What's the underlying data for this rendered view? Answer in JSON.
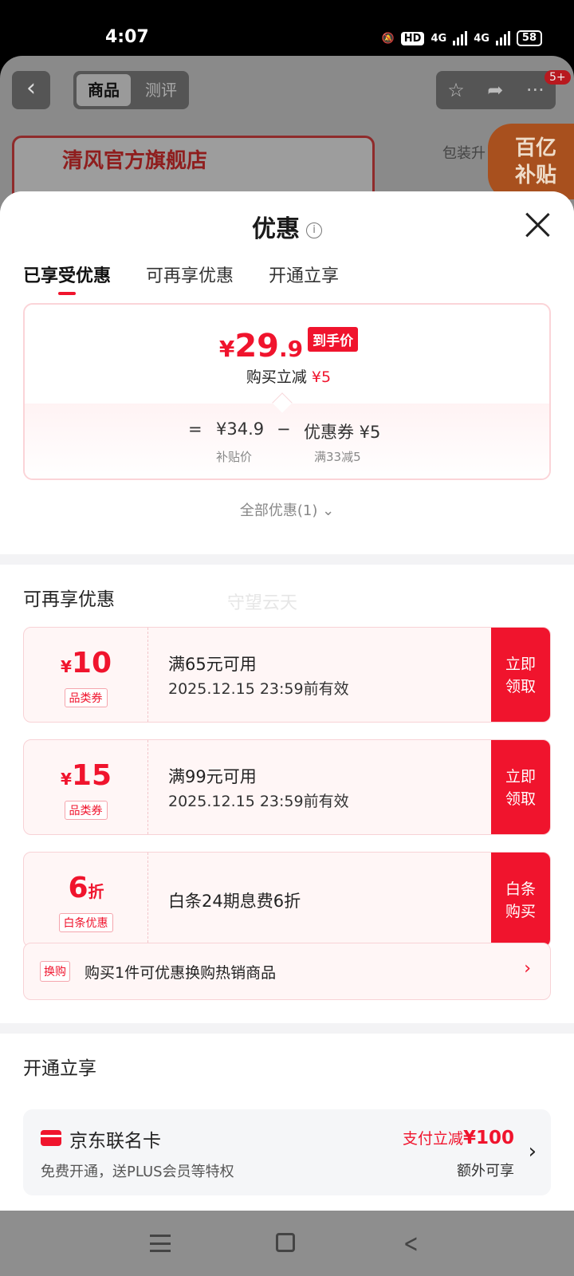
{
  "status_bar": {
    "time": "4:07",
    "hd": "HD",
    "network1": "4G",
    "network2": "4G",
    "battery": "58",
    "icons": [
      "mute-icon",
      "signal-icon",
      "battery-icon"
    ]
  },
  "background_page": {
    "tab_product": "商品",
    "tab_review": "测评",
    "badge": "5+",
    "store_name": "清风官方旗舰店",
    "pack_text": "包装升",
    "promo_line1": "百亿",
    "promo_line2": "补贴"
  },
  "sheet": {
    "title": "优惠",
    "tabs": [
      "已享受优惠",
      "可再享优惠",
      "开通立享"
    ],
    "active_tab": 0
  },
  "price_box": {
    "currency": "¥",
    "price_int": "29",
    "price_dec": ".9",
    "tag": "到手价",
    "reduce_label": "购买立减",
    "reduce_value": "¥5",
    "eq": "=",
    "original": "¥34.9",
    "minus": "−",
    "coupon": "优惠券 ¥5",
    "original_label": "补贴价",
    "coupon_label": "满33减5"
  },
  "all_offers": "全部优惠(1)",
  "more_section": {
    "title": "可再享优惠",
    "watermark": "守望云天",
    "coupons": [
      {
        "symbol": "¥",
        "value": "10",
        "tag": "品类券",
        "line1": "满65元可用",
        "line2": "2025.12.15 23:59前有效",
        "button": "立即 领取"
      },
      {
        "symbol": "¥",
        "value": "15",
        "tag": "品类券",
        "line1": "满99元可用",
        "line2": "2025.12.15 23:59前有效",
        "button": "立即 领取"
      },
      {
        "symbol": "折",
        "value": "6",
        "tag": "白条优惠",
        "line1": "白条24期息费6折",
        "line2": "",
        "button": "白条 购买"
      }
    ],
    "swap": {
      "tag": "换购",
      "text": "购买1件可优惠换购热销商品"
    }
  },
  "open_section": {
    "title": "开通立享",
    "card_name": "京东联名卡",
    "card_desc": "免费开通，送PLUS会员等特权",
    "promo_prefix": "支付立减",
    "promo_value": "¥100",
    "extra": "额外可享"
  },
  "colors": {
    "accent": "#f0142d",
    "sheet_bg": "#f3f3f5"
  }
}
